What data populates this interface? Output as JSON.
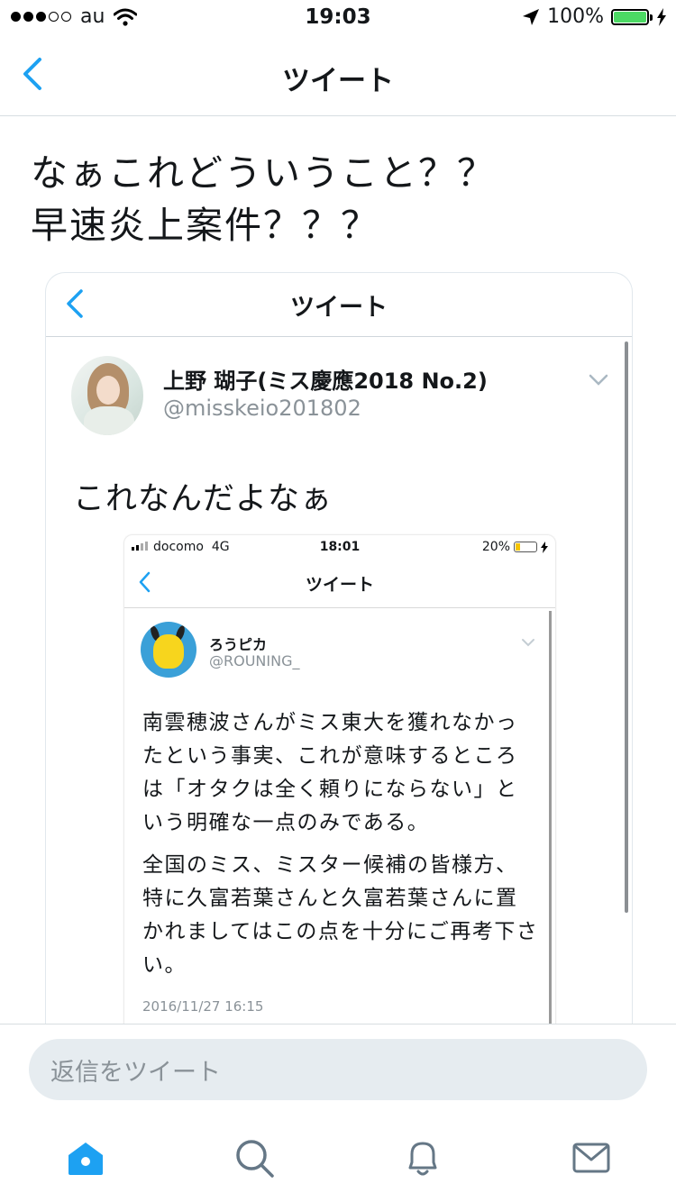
{
  "status_bar": {
    "carrier": "au",
    "time": "19:03",
    "battery_percent": "100%",
    "battery_level": 1.0,
    "signal_dots_filled": 3,
    "signal_dots_total": 5,
    "icons": [
      "wifi-icon",
      "location-arrow-icon",
      "battery-icon",
      "charging-bolt-icon"
    ]
  },
  "nav": {
    "title": "ツイート",
    "back_icon": "chevron-left-icon"
  },
  "tweet": {
    "lines": [
      "なぁこれどういうこと？？",
      "早速炎上案件？？？"
    ]
  },
  "embedded": {
    "nav_title": "ツイート",
    "author_name": "上野 瑚子(ミス慶應2018 No.2)",
    "author_handle": "@misskeio201802",
    "text": "これなんだよなぁ",
    "inner": {
      "carrier": "docomo",
      "network": "4G",
      "time": "18:01",
      "battery_percent": "20%",
      "battery_level": 0.2,
      "nav_title": "ツイート",
      "author_name": "ろうピカ",
      "author_handle": "@ROUNING_",
      "paragraphs": [
        "南雲穂波さんがミス東大を獲れなかったという事実、これが意味するところは「オタクは全く頼りにならない」という明確な一点のみである。",
        "全国のミス、ミスター候補の皆様方、特に久富若葉さんと久富若葉さんに置かれましてはこの点を十分にご再考下さい。"
      ],
      "date": "2016/11/27 16:15"
    }
  },
  "reply": {
    "placeholder": "返信をツイート"
  },
  "tabs": [
    {
      "icon": "home-icon",
      "active": true
    },
    {
      "icon": "search-icon",
      "active": false
    },
    {
      "icon": "notifications-bell-icon",
      "active": false
    },
    {
      "icon": "messages-envelope-icon",
      "active": false
    }
  ],
  "colors": {
    "accent": "#1da1f2",
    "text": "#14171a",
    "secondary_text": "#8a9298",
    "reply_bg": "#e6ecf0",
    "battery_green": "#4cd964"
  }
}
